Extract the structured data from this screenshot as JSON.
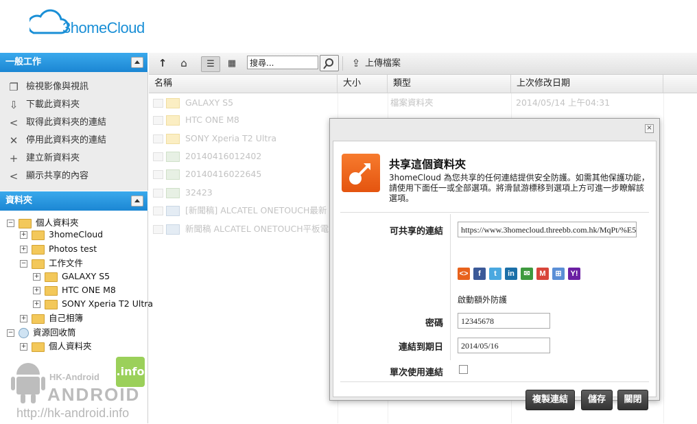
{
  "logo": {
    "text": "3homeCloud"
  },
  "tasks": {
    "title": "一般工作",
    "items": [
      {
        "label": "檢視影像與視訊",
        "icon": "view-media-icon"
      },
      {
        "label": "下載此資料夾",
        "icon": "download-icon"
      },
      {
        "label": "取得此資料夾的連結",
        "icon": "share-link-icon"
      },
      {
        "label": "停用此資料夾的連結",
        "icon": "disable-link-icon"
      },
      {
        "label": "建立新資料夾",
        "icon": "new-folder-icon"
      },
      {
        "label": "顯示共享的內容",
        "icon": "shared-content-icon"
      }
    ]
  },
  "folders": {
    "title": "資料夾",
    "tree": [
      {
        "label": "個人資料夾",
        "toggle": "−"
      },
      {
        "label": "3homeCloud",
        "toggle": "+"
      },
      {
        "label": "Photos test",
        "toggle": "+"
      },
      {
        "label": "工作文件",
        "toggle": "−"
      },
      {
        "label": "GALAXY S5",
        "toggle": "+"
      },
      {
        "label": "HTC ONE M8",
        "toggle": "+"
      },
      {
        "label": "SONY Xperia T2 Ultra",
        "toggle": "+"
      },
      {
        "label": "自己相簿",
        "toggle": "+"
      },
      {
        "label": "資源回收筒",
        "toggle": "−"
      },
      {
        "label": "個人資料夾",
        "toggle": "+"
      }
    ]
  },
  "toolbar": {
    "search_placeholder": "搜尋...",
    "upload_label": "上傳檔案"
  },
  "table": {
    "headers": [
      "名稱",
      "大小",
      "類型",
      "上次修改日期"
    ],
    "rows": [
      {
        "name": "GALAXY S5",
        "size": "",
        "type": "檔案資料夾",
        "modified": "2014/05/14 上午04:31"
      },
      {
        "name": "HTC ONE M8",
        "size": "",
        "type": "",
        "modified": ""
      },
      {
        "name": "SONY Xperia T2 Ultra",
        "size": "",
        "type": "",
        "modified": ""
      },
      {
        "name": "20140416012402",
        "size": "",
        "type": "",
        "modified": ""
      },
      {
        "name": "20140416022645",
        "size": "",
        "type": "",
        "modified": ""
      },
      {
        "name": "32423",
        "size": "",
        "type": "",
        "modified": ""
      },
      {
        "name": "[新聞稿] ALCATEL ONETOUCH最新",
        "size": "",
        "type": "",
        "modified": ""
      },
      {
        "name": "新聞稿 ALCATEL ONETOUCH平板電",
        "size": "",
        "type": "",
        "modified": ""
      }
    ]
  },
  "watermark": {
    "brand": "HK-Android",
    "big": "ANDROID",
    "badge": ".info",
    "site": "http://hk-android.info"
  },
  "modal": {
    "close": "×",
    "title": "共享這個資料夾",
    "description": "3homeCloud 為您共享的任何連結提供安全防護。如需其他保護功能，請使用下面任一或全部選項。將滑鼠游標移到選項上方可進一步瞭解該選項。",
    "link_label": "可共享的連結",
    "link_value": "https://www.3homecloud.threebb.com.hk/MqPt/%E5",
    "extra_label": "啟動額外防護",
    "password_label": "密碼",
    "password_value": "12345678",
    "expiry_label": "連結到期日",
    "expiry_value": "2014/05/16",
    "single_use_label": "單次使用連結",
    "single_use_checked": false,
    "buttons": {
      "copy": "複製連結",
      "save": "儲存",
      "close": "關閉"
    },
    "social": [
      {
        "name": "embed-icon",
        "glyph": "<>",
        "color": "#e8621c"
      },
      {
        "name": "facebook-icon",
        "glyph": "f",
        "color": "#3b5998"
      },
      {
        "name": "twitter-icon",
        "glyph": "t",
        "color": "#4aa8e0"
      },
      {
        "name": "linkedin-icon",
        "glyph": "in",
        "color": "#1b6fa8"
      },
      {
        "name": "email-icon",
        "glyph": "✉",
        "color": "#3f9a3f"
      },
      {
        "name": "gmail-icon",
        "glyph": "M",
        "color": "#d8453a"
      },
      {
        "name": "windows-live-icon",
        "glyph": "⊞",
        "color": "#5a8fd6"
      },
      {
        "name": "yahoo-icon",
        "glyph": "Y!",
        "color": "#6b1fa3"
      }
    ]
  }
}
